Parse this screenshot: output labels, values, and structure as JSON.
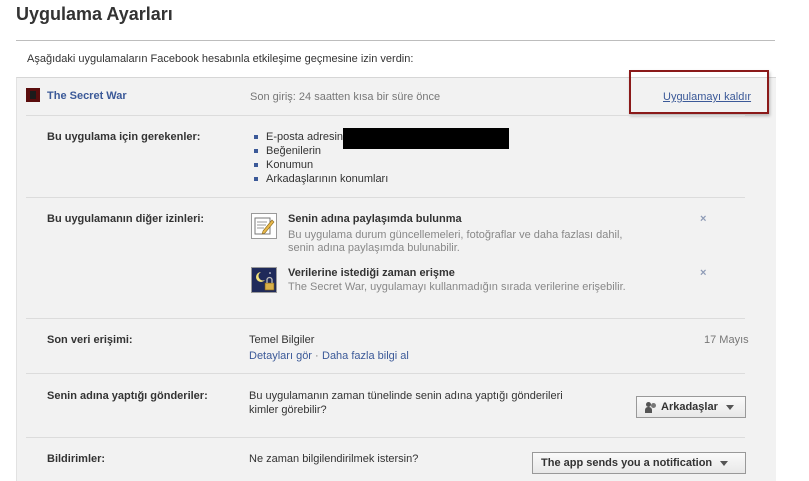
{
  "page": {
    "title": "Uygulama Ayarları",
    "intro": "Aşağıdaki uygulamaların Facebook hesabınla etkileşime geçmesine izin verdin:"
  },
  "app": {
    "name": "The Secret War",
    "last_login": "Son giriş: 24 saatten kısa bir süre önce",
    "remove_label": "Uygulamayı kaldır"
  },
  "required_permissions": {
    "label": "Bu uygulama için gerekenler:",
    "items": [
      "E-posta adresin",
      "Beğenilerin",
      "Konumun",
      "Arkadaşlarının konumları"
    ]
  },
  "other_permissions": {
    "label": "Bu uygulamanın diğer izinleri:",
    "items": [
      {
        "title": "Senin adına paylaşımda bulunma",
        "desc_line1": "Bu uygulama durum güncellemeleri, fotoğraflar ve daha fazlası dahil,",
        "desc_line2": "senin adına paylaşımda bulunabilir.",
        "icon": "edit-post-icon",
        "remove": "×"
      },
      {
        "title": "Verilerine istediği zaman erişme",
        "desc_line1": "The Secret War, uygulamayı kullanmadığın sırada verilerine erişebilir.",
        "icon": "offline-access-icon",
        "remove": "×"
      }
    ]
  },
  "last_data_access": {
    "label": "Son veri erişimi:",
    "value": "Temel Bilgiler",
    "details_link": "Detayları gör",
    "separator": "·",
    "more_link": "Daha fazla bilgi al",
    "date": "17 Mayıs"
  },
  "posts_on_behalf": {
    "label": "Senin adına yaptığı gönderiler:",
    "question_line1": "Bu uygulamanın zaman tünelinde senin adına yaptığı gönderileri",
    "question_line2": "kimler görebilir?",
    "audience": "Arkadaşlar"
  },
  "notifications": {
    "label": "Bildirimler:",
    "question": "Ne zaman bilgilendirilmek istersin?",
    "selected": "The app sends you a notification"
  },
  "colors": {
    "link": "#3b5998",
    "panel_bg": "#f2f2f2",
    "highlight_border": "#8b1a1a"
  }
}
